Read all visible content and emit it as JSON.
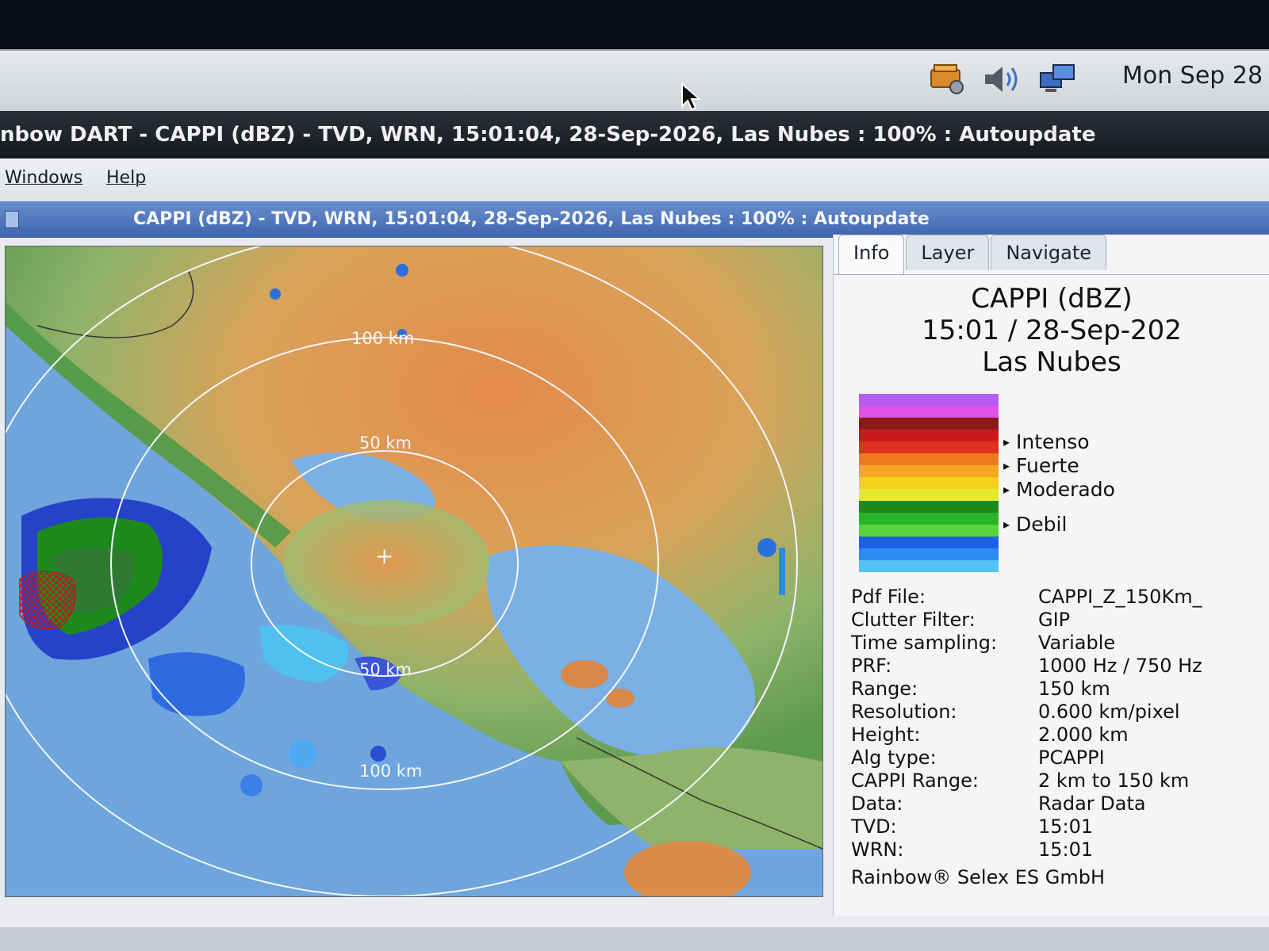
{
  "system_panel": {
    "clock": "Mon Sep 28",
    "icons": [
      "updates-icon",
      "volume-icon",
      "network-icon"
    ]
  },
  "main_window": {
    "title": "nbow DART - CAPPI (dBZ) - TVD, WRN, 15:01:04, 28-Sep-2026, Las Nubes : 100% : Autoupdate",
    "menu": [
      "Windows",
      "Help"
    ]
  },
  "inner_window": {
    "title": "CAPPI (dBZ) - TVD, WRN, 15:01:04, 28-Sep-2026, Las Nubes : 100% : Autoupdate"
  },
  "map": {
    "range_labels": [
      "100 km",
      "50 km",
      "50 km",
      "100 km"
    ],
    "center_marker": "+"
  },
  "panel": {
    "tabs": [
      {
        "label": "Info",
        "active": true
      },
      {
        "label": "Layer",
        "active": false
      },
      {
        "label": "Navigate",
        "active": false
      }
    ],
    "info_title": [
      "CAPPI (dBZ)",
      "15:01 / 28-Sep-202",
      "Las Nubes"
    ],
    "legend_colors": [
      "#b65cf0",
      "#e052e8",
      "#8a1a1a",
      "#c81c1c",
      "#e0301f",
      "#ee7a20",
      "#f5a623",
      "#f3d21b",
      "#e6ea2a",
      "#1e8a1e",
      "#26b526",
      "#57d43a",
      "#1f5fe6",
      "#2c8cf2",
      "#52c4f4"
    ],
    "legend_labels": [
      "Intenso",
      "Fuerte",
      "Moderado",
      "Debil"
    ],
    "properties": [
      {
        "key": "Pdf File:",
        "value": "CAPPI_Z_150Km_"
      },
      {
        "key": "Clutter Filter:",
        "value": "GIP"
      },
      {
        "key": "Time sampling:",
        "value": "Variable"
      },
      {
        "key": "PRF:",
        "value": "1000 Hz / 750 Hz"
      },
      {
        "key": "Range:",
        "value": "150 km"
      },
      {
        "key": "Resolution:",
        "value": "0.600 km/pixel"
      },
      {
        "key": "Height:",
        "value": "2.000 km"
      },
      {
        "key": "Alg type:",
        "value": "PCAPPI"
      },
      {
        "key": "CAPPI Range:",
        "value": "2 km to 150 km"
      },
      {
        "key": "Data:",
        "value": "Radar Data"
      },
      {
        "key": "TVD:",
        "value": "15:01"
      },
      {
        "key": "WRN:",
        "value": "15:01"
      }
    ],
    "copyright": "Rainbow® Selex ES GmbH"
  }
}
